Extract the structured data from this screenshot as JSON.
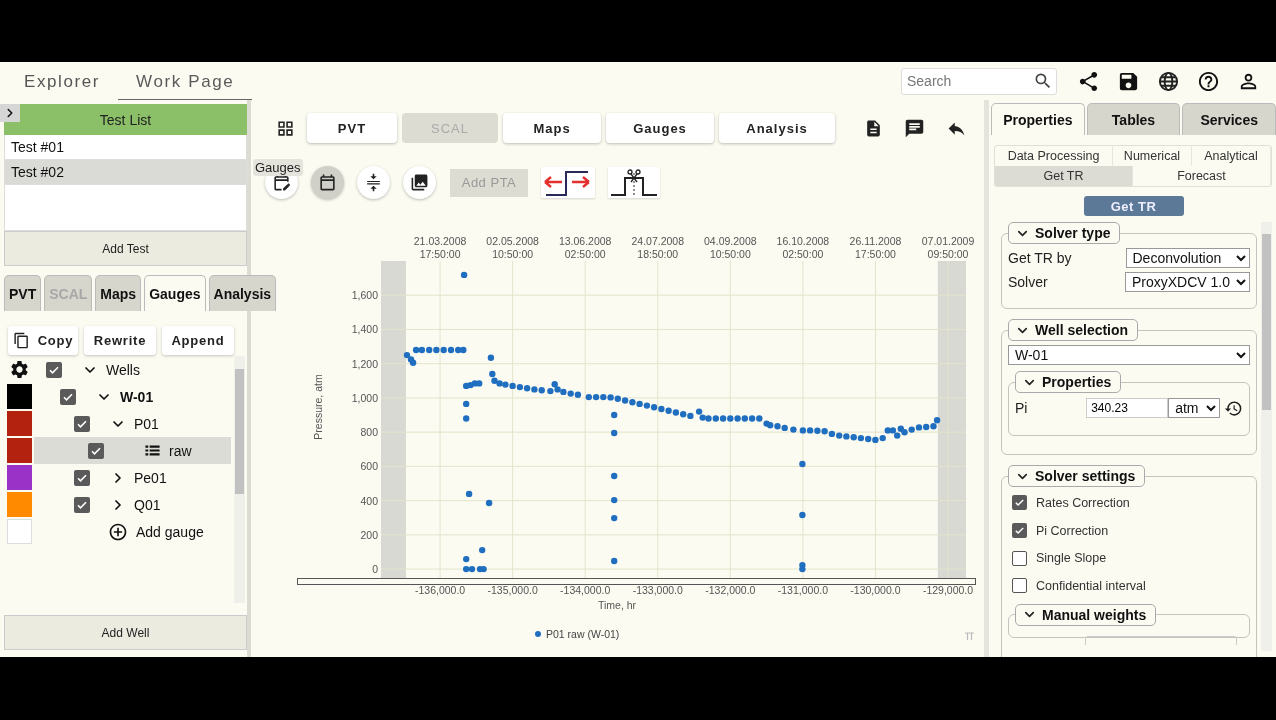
{
  "topbar": {
    "tabs": [
      {
        "label": "Explorer",
        "selected": false
      },
      {
        "label": "Work Page",
        "selected": true
      }
    ],
    "search": {
      "placeholder": "Search"
    }
  },
  "left_panel": {
    "title": "Test List",
    "tests": [
      {
        "label": "Test #01",
        "selected": false
      },
      {
        "label": "Test #02",
        "selected": true
      }
    ],
    "add_test": "Add Test",
    "tabs": [
      {
        "label": "PVT",
        "selected": false,
        "disabled": false
      },
      {
        "label": "SCAL",
        "selected": false,
        "disabled": true
      },
      {
        "label": "Maps",
        "selected": false,
        "disabled": false
      },
      {
        "label": "Gauges",
        "selected": true,
        "disabled": false
      },
      {
        "label": "Analysis",
        "selected": false,
        "disabled": false
      }
    ],
    "actions": [
      {
        "label": "Copy",
        "kind": "copy"
      },
      {
        "label": "Rewrite",
        "kind": "plain"
      },
      {
        "label": "Append",
        "kind": "plain"
      }
    ],
    "tree": [
      {
        "label": "Wells",
        "kind": "root",
        "checked": true,
        "expanded": true,
        "selected": false,
        "children": [
          {
            "label": "W-01",
            "kind": "well",
            "checked": true,
            "expanded": true,
            "selected": false,
            "color": "#000000",
            "children": [
              {
                "label": "P01",
                "kind": "gauge",
                "checked": true,
                "expanded": true,
                "selected": false,
                "color": "#b3220e",
                "children": [
                  {
                    "label": "raw",
                    "kind": "series",
                    "checked": true,
                    "selected": true,
                    "color": "#b3220e"
                  }
                ]
              },
              {
                "label": "Pe01",
                "kind": "gauge",
                "checked": true,
                "expanded": false,
                "selected": false,
                "color": "#9a32c8"
              },
              {
                "label": "Q01",
                "kind": "gauge",
                "checked": true,
                "expanded": false,
                "selected": false,
                "color": "#ff8a00"
              }
            ]
          }
        ]
      }
    ],
    "add_gauge": "Add gauge",
    "add_well": "Add Well"
  },
  "center": {
    "tabs": [
      {
        "label": "PVT",
        "disabled": false
      },
      {
        "label": "SCAL",
        "disabled": true
      },
      {
        "label": "Maps",
        "disabled": false
      },
      {
        "label": "Gauges",
        "disabled": false
      },
      {
        "label": "Analysis",
        "disabled": false
      }
    ],
    "tooltip": "Gauges",
    "tools": [
      {
        "kind": "calendar-edit",
        "selected": false
      },
      {
        "kind": "calendar",
        "selected": true
      },
      {
        "kind": "compress",
        "selected": false
      },
      {
        "kind": "images",
        "selected": false
      }
    ],
    "add_pta": {
      "label": "Add PTA",
      "disabled": true
    },
    "chart": {
      "top_ticks": [
        {
          "date": "21.03.2008",
          "time": "17:50:00"
        },
        {
          "date": "02.05.2008",
          "time": "10:50:00"
        },
        {
          "date": "13.06.2008",
          "time": "02:50:00"
        },
        {
          "date": "24.07.2008",
          "time": "18:50:00"
        },
        {
          "date": "04.09.2008",
          "time": "10:50:00"
        },
        {
          "date": "16.10.2008",
          "time": "02:50:00"
        },
        {
          "date": "26.11.2008",
          "time": "17:50:00"
        },
        {
          "date": "07.01.2009",
          "time": "09:50:00"
        }
      ],
      "chart_data": {
        "type": "scatter",
        "xlabel": "Time, hr",
        "ylabel": "Pressure, atm",
        "xlim": [
          -136814,
          -128752
        ],
        "ylim": [
          -58,
          1800
        ],
        "xticks": [
          {
            "value": -136000,
            "label": "-136,000.0"
          },
          {
            "value": -135000,
            "label": "-135,000.0"
          },
          {
            "value": -134000,
            "label": "-134,000.0"
          },
          {
            "value": -133000,
            "label": "-133,000.0"
          },
          {
            "value": -132000,
            "label": "-132,000.0"
          },
          {
            "value": -131000,
            "label": "-131,000.0"
          },
          {
            "value": -130000,
            "label": "-130,000.0"
          },
          {
            "value": -129000,
            "label": "-129,000.0"
          }
        ],
        "yticks": [
          {
            "value": 0,
            "label": "0"
          },
          {
            "value": 200,
            "label": "200"
          },
          {
            "value": 400,
            "label": "400"
          },
          {
            "value": 600,
            "label": "600"
          },
          {
            "value": 800,
            "label": "800"
          },
          {
            "value": 1000,
            "label": "1,000"
          },
          {
            "value": 1200,
            "label": "1,200"
          },
          {
            "value": 1400,
            "label": "1,400"
          },
          {
            "value": 1600,
            "label": "1,600"
          }
        ],
        "grid": true,
        "bands": [
          {
            "axis": "x",
            "from": -136814,
            "to": -136470
          },
          {
            "axis": "x",
            "from": -129140,
            "to": -128752
          }
        ],
        "x": [
          -136455,
          -136400,
          -136372,
          -136330,
          -136250,
          -136150,
          -136050,
          -135950,
          -135850,
          -135750,
          -135680,
          -135640,
          -135580,
          -135520,
          -135460,
          -135300,
          -135280,
          -135250,
          -135180,
          -135100,
          -135000,
          -134900,
          -134800,
          -134700,
          -134600,
          -134480,
          -134420,
          -134380,
          -134300,
          -134200,
          -134100,
          -133950,
          -133850,
          -133750,
          -133650,
          -133550,
          -133450,
          -133350,
          -133250,
          -133150,
          -133050,
          -132950,
          -132850,
          -132750,
          -132650,
          -132550,
          -132430,
          -132380,
          -132300,
          -132200,
          -132100,
          -132000,
          -131900,
          -131800,
          -131700,
          -131600,
          -131500,
          -131450,
          -131350,
          -131250,
          -131130,
          -131000,
          -130900,
          -130800,
          -130700,
          -130600,
          -130500,
          -130400,
          -130300,
          -130200,
          -130100,
          -130000,
          -129900,
          -129830,
          -129760,
          -129700,
          -129650,
          -129600,
          -129500,
          -129400,
          -129300,
          -129200,
          -129150,
          -135669,
          -135640,
          -135640,
          -135600,
          -135324,
          -135640,
          -135420,
          -135640,
          -135560,
          -135450,
          -135400,
          -133600,
          -133600,
          -133600,
          -133600,
          -133600,
          -133600,
          -131007,
          -131007,
          -131007,
          -131007
        ],
        "series": [
          {
            "name": "P01 raw (W-01)",
            "color": "#1f6ebf",
            "values": [
              1250,
              1225,
              1205,
              1280,
              1280,
              1280,
              1280,
              1280,
              1280,
              1280,
              1280,
              1070,
              1075,
              1085,
              1085,
              1235,
              1140,
              1100,
              1085,
              1078,
              1070,
              1063,
              1057,
              1050,
              1045,
              1040,
              1080,
              1050,
              1035,
              1025,
              1018,
              1005,
              1005,
              1005,
              1003,
              995,
              985,
              975,
              965,
              955,
              945,
              935,
              925,
              915,
              905,
              895,
              920,
              885,
              880,
              880,
              880,
              880,
              880,
              880,
              880,
              880,
              850,
              840,
              835,
              825,
              815,
              810,
              810,
              808,
              805,
              790,
              780,
              775,
              770,
              765,
              760,
              755,
              765,
              810,
              810,
              780,
              820,
              800,
              815,
              828,
              830,
              835,
              870,
              1719,
              965,
              880,
              439,
              386,
              58,
              111,
              0,
              0,
              0,
              0,
              900,
              795,
              544,
              403,
              298,
              47,
              614,
              316,
              23,
              0
            ]
          }
        ]
      }
    }
  },
  "right_panel": {
    "tabs": [
      {
        "label": "Properties",
        "selected": true
      },
      {
        "label": "Tables",
        "selected": false
      },
      {
        "label": "Services",
        "selected": false
      }
    ],
    "subtabs": [
      [
        {
          "label": "Data Processing",
          "selected": false
        },
        {
          "label": "Numerical",
          "selected": false
        },
        {
          "label": "Analytical",
          "selected": false
        }
      ],
      [
        {
          "label": "Get TR",
          "selected": true
        },
        {
          "label": "Forecast",
          "selected": false
        }
      ]
    ],
    "action": "Get TR",
    "solver_type": {
      "title": "Solver type",
      "expanded": true,
      "fields": [
        {
          "label": "Get TR by",
          "value": "Deconvolution"
        },
        {
          "label": "Solver",
          "value": "ProxyXDCV 1.0"
        }
      ]
    },
    "well_selection": {
      "title": "Well selection",
      "expanded": true,
      "well": "W-01",
      "properties": {
        "title": "Properties",
        "expanded": true,
        "label": "Pi",
        "value": "340.23",
        "unit": "atm"
      }
    },
    "solver_settings": {
      "title": "Solver settings",
      "expanded": true,
      "options": [
        {
          "label": "Rates Correction",
          "checked": true
        },
        {
          "label": "Pi Correction",
          "checked": true
        },
        {
          "label": "Single Slope",
          "checked": false
        },
        {
          "label": "Confidential interval",
          "checked": false
        }
      ],
      "manual_weights": {
        "title": "Manual weights",
        "expanded": true
      }
    }
  }
}
